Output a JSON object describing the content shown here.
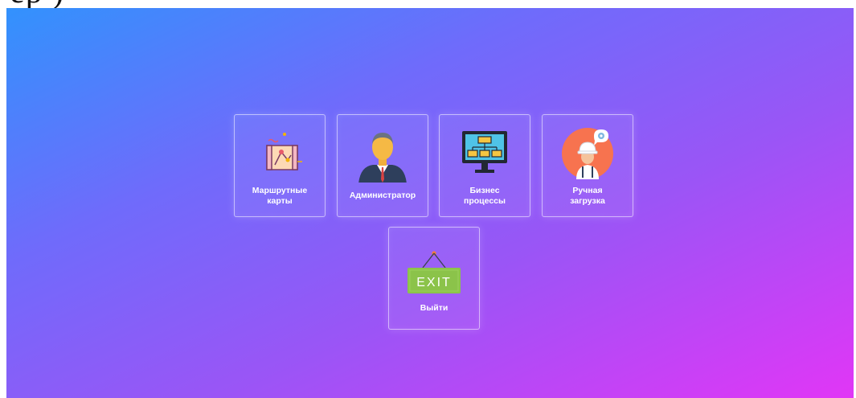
{
  "header_fragment": "ер )",
  "tiles": [
    {
      "label": "Маршрутные\nкарты",
      "icon": "route-map-icon"
    },
    {
      "label": "Администратор",
      "icon": "administrator-icon"
    },
    {
      "label": "Бизнес\nпроцессы",
      "icon": "business-process-icon"
    },
    {
      "label": "Ручная\nзагрузка",
      "icon": "manual-upload-icon"
    }
  ],
  "exit": {
    "label": "Выйти",
    "sign_text": "EXIT",
    "icon": "exit-sign-icon"
  },
  "colors": {
    "gradient_start": "#3292fd",
    "gradient_end": "#e136f6",
    "exit_green": "#8bc34a",
    "avatar_orange": "#f7734f"
  }
}
